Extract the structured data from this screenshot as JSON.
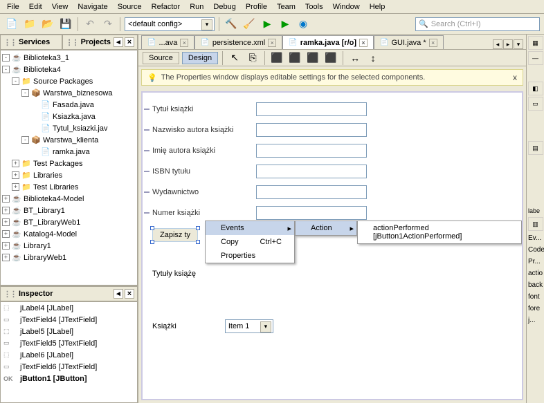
{
  "menu": [
    "File",
    "Edit",
    "View",
    "Navigate",
    "Source",
    "Refactor",
    "Run",
    "Debug",
    "Profile",
    "Team",
    "Tools",
    "Window",
    "Help"
  ],
  "toolbar": {
    "config": "<default config>",
    "search_placeholder": "Search (Ctrl+I)"
  },
  "panels": {
    "services": "Services",
    "projects": "Projects",
    "inspector": "Inspector"
  },
  "projectsTree": [
    {
      "ind": 0,
      "exp": "-",
      "ic": "coffee",
      "label": "Biblioteka3_1"
    },
    {
      "ind": 0,
      "exp": "-",
      "ic": "coffee",
      "label": "Biblioteka4"
    },
    {
      "ind": 1,
      "exp": "-",
      "ic": "fold",
      "label": "Source Packages"
    },
    {
      "ind": 2,
      "exp": "-",
      "ic": "pkg",
      "label": "Warstwa_biznesowa"
    },
    {
      "ind": 3,
      "exp": "",
      "ic": "jav",
      "label": "Fasada.java"
    },
    {
      "ind": 3,
      "exp": "",
      "ic": "jav",
      "label": "Ksiazka.java"
    },
    {
      "ind": 3,
      "exp": "",
      "ic": "jav",
      "label": "Tytul_ksiazki.jav"
    },
    {
      "ind": 2,
      "exp": "-",
      "ic": "pkg",
      "label": "Warstwa_klienta"
    },
    {
      "ind": 3,
      "exp": "",
      "ic": "jav",
      "label": "ramka.java"
    },
    {
      "ind": 1,
      "exp": "+",
      "ic": "fold",
      "label": "Test Packages"
    },
    {
      "ind": 1,
      "exp": "+",
      "ic": "fold",
      "label": "Libraries"
    },
    {
      "ind": 1,
      "exp": "+",
      "ic": "fold",
      "label": "Test Libraries"
    },
    {
      "ind": 0,
      "exp": "+",
      "ic": "coffee",
      "label": "Biblioteka4-Model"
    },
    {
      "ind": 0,
      "exp": "+",
      "ic": "coffee",
      "label": "BT_Library1"
    },
    {
      "ind": 0,
      "exp": "+",
      "ic": "coffee",
      "label": "BT_LibraryWeb1"
    },
    {
      "ind": 0,
      "exp": "+",
      "ic": "coffee",
      "label": "Katalog4-Model"
    },
    {
      "ind": 0,
      "exp": "+",
      "ic": "coffee",
      "label": "Library1"
    },
    {
      "ind": 0,
      "exp": "+",
      "ic": "coffee",
      "label": "LibraryWeb1"
    }
  ],
  "inspectorList": [
    {
      "label": "jLabel4 [JLabel]",
      "bold": false,
      "ic": "label"
    },
    {
      "label": "jTextField4 [JTextField]",
      "bold": false,
      "ic": "txt"
    },
    {
      "label": "jLabel5 [JLabel]",
      "bold": false,
      "ic": "label"
    },
    {
      "label": "jTextField5 [JTextField]",
      "bold": false,
      "ic": "txt"
    },
    {
      "label": "jLabel6 [JLabel]",
      "bold": false,
      "ic": "label"
    },
    {
      "label": "jTextField6 [JTextField]",
      "bold": false,
      "ic": "txt"
    },
    {
      "label": "jButton1 [JButton]",
      "bold": true,
      "ic": "btn"
    }
  ],
  "editorTabs": [
    {
      "label": "...ava",
      "active": false,
      "close": true
    },
    {
      "label": "persistence.xml",
      "active": false,
      "close": true
    },
    {
      "label": "ramka.java [r/o]",
      "active": true,
      "close": true
    },
    {
      "label": "GUI.java *",
      "active": false,
      "close": true
    }
  ],
  "subToolbar": {
    "source": "Source",
    "design": "Design"
  },
  "infoBar": "The Properties window displays editable settings for the selected components.",
  "formLabels": [
    "Tytuł książki",
    "Nazwisko autora książki",
    "Imię autora książki",
    "ISBN tytułu",
    "Wydawnictwo",
    "Numer książki"
  ],
  "buttonLabel": "Zapisz ty",
  "bottomLabels": {
    "tytuly": "Tytuły książę",
    "ksiazki": "Książki",
    "item": "Item 1"
  },
  "contextMenu": {
    "events": "Events",
    "copy": "Copy",
    "copyKey": "Ctrl+C",
    "properties": "Properties",
    "submenu": "Action",
    "action": "actionPerformed [jButton1ActionPerformed]"
  },
  "rightPanel": [
    "Ev...",
    "Code",
    "Pr...",
    "actio",
    "back",
    "font",
    "fore",
    "j..."
  ]
}
